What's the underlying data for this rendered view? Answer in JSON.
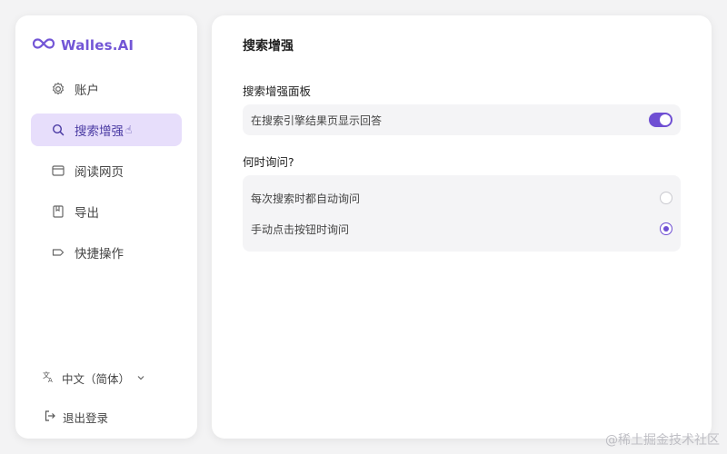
{
  "brand": {
    "name": "Walles.AI",
    "accent": "#7356d6"
  },
  "sidebar": {
    "items": [
      {
        "label": "账户",
        "icon": "gear-icon"
      },
      {
        "label": "搜索增强",
        "icon": "search-icon",
        "active": true
      },
      {
        "label": "阅读网页",
        "icon": "browser-window-icon"
      },
      {
        "label": "导出",
        "icon": "bookmark-icon"
      },
      {
        "label": "快捷操作",
        "icon": "tag-icon"
      }
    ],
    "language": "中文（简体）",
    "logout": "退出登录"
  },
  "main": {
    "title": "搜索增强",
    "panel_section": {
      "label": "搜索增强面板",
      "toggle_label": "在搜索引擎结果页显示回答",
      "toggle_on": true
    },
    "ask_section": {
      "label": "何时询问?",
      "options": [
        {
          "label": "每次搜索时都自动询问",
          "selected": false
        },
        {
          "label": "手动点击按钮时询问",
          "selected": true
        }
      ]
    }
  },
  "watermark": "@稀土掘金技术社区",
  "colors": {
    "active_bg": "#e7defb",
    "toggle": "#6f4fd3",
    "card_bg": "#f4f4f6"
  }
}
